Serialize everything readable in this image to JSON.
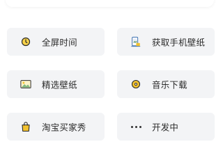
{
  "colors": {
    "tile_background": "#f3f4f6",
    "accent_yellow": "#f2c230",
    "text": "#2b2b2b"
  },
  "features": [
    {
      "label": "全屏时间",
      "icon": "clock-icon"
    },
    {
      "label": "获取手机壁纸",
      "icon": "phone-wallpaper-icon"
    },
    {
      "label": "精选壁纸",
      "icon": "picture-icon"
    },
    {
      "label": "音乐下载",
      "icon": "music-disc-icon"
    },
    {
      "label": "淘宝买家秀",
      "icon": "shopping-bag-icon"
    },
    {
      "label": "开发中",
      "icon": "more-dots-icon"
    }
  ]
}
